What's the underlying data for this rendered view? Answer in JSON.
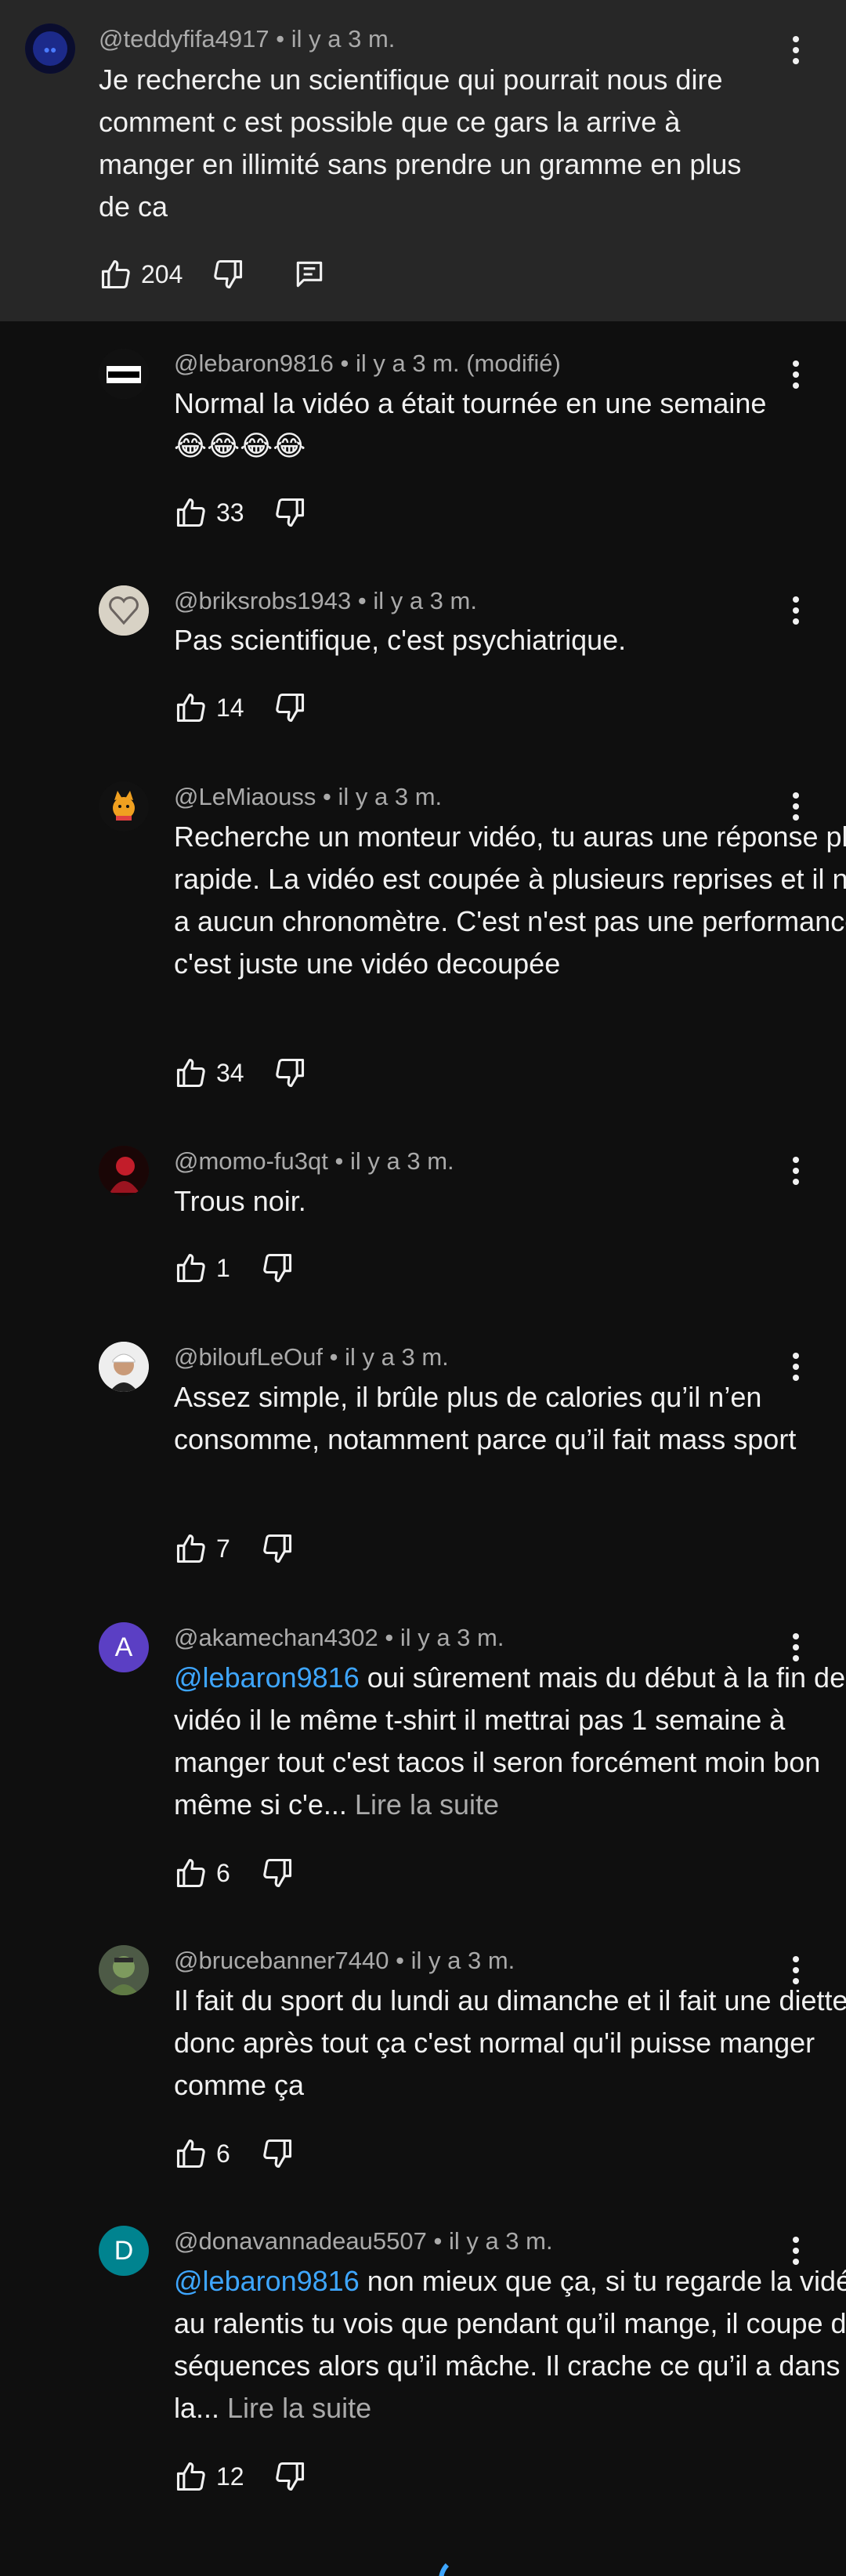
{
  "parent": {
    "handle": "@teddyfifa4917",
    "time": "il y a 3 m.",
    "text": "Je recherche un scientifique qui pourrait nous dire comment c est possible que ce gars la arrive à manger en illimité sans prendre un gramme en plus de ca",
    "likes": "204"
  },
  "replies": [
    {
      "handle": "@lebaron9816",
      "time": "il y a 3 m. (modifié)",
      "text": "Normal la vidéo a était tournée en une semaine 😂😂😂😂",
      "likes": "33"
    },
    {
      "handle": "@briksrobs1943",
      "time": "il y a 3 m.",
      "text": "Pas scientifique, c'est psychiatrique.",
      "likes": "14"
    },
    {
      "handle": "@LeMiaouss",
      "time": "il y a 3 m.",
      "text": "Recherche un monteur vidéo, tu auras une réponse plus rapide. La vidéo est coupée à plusieurs reprises et il n'y a aucun chronomètre. C'est n'est pas une performance, c'est juste une vidéo decoupée",
      "likes": "34"
    },
    {
      "handle": "@momo-fu3qt",
      "time": "il y a 3 m.",
      "text": "Trous noir.",
      "likes": "1"
    },
    {
      "handle": "@biloufLeOuf",
      "time": "il y a 3 m.",
      "text": "Assez simple, il brûle plus de calories qu’il n’en consomme, notamment parce qu’il fait mass sport",
      "likes": "7"
    },
    {
      "handle": "@akamechan4302",
      "time": "il y a 3 m.",
      "avatar_letter": "A",
      "mention": "@lebaron9816",
      "text": " oui sûrement mais du début à la fin de la vidéo il  le même t-shirt il mettrai pas 1 semaine à manger tout c'est tacos il seron forcément moin bon même si c'e...",
      "more": " Lire la suite",
      "likes": "6"
    },
    {
      "handle": "@brucebanner7440",
      "time": "il y a 3 m.",
      "text": "Il fait du sport du lundi au dimanche et il fait une diette donc après tout ça c'est normal qu'il puisse manger comme ça",
      "likes": "6"
    },
    {
      "handle": "@donavannadeau5507",
      "time": "il y a 3 m.",
      "avatar_letter": "D",
      "mention": "@lebaron9816",
      "text": "  non mieux que ça, si tu regarde la vidéo au ralentis tu vois que pendant qu’il mange, il coupe des séquences alors qu’il mâche. Il crache ce qu’il a dans la...",
      "more": " Lire la suite",
      "likes": "12"
    }
  ],
  "separator": "•",
  "colors": {
    "background": "#0f0f0f",
    "parent_bg": "#272727",
    "mention": "#3ea6ff",
    "meta": "#aaaaaa",
    "avatar_a": "#5b3fc4",
    "avatar_d": "#00838f"
  }
}
